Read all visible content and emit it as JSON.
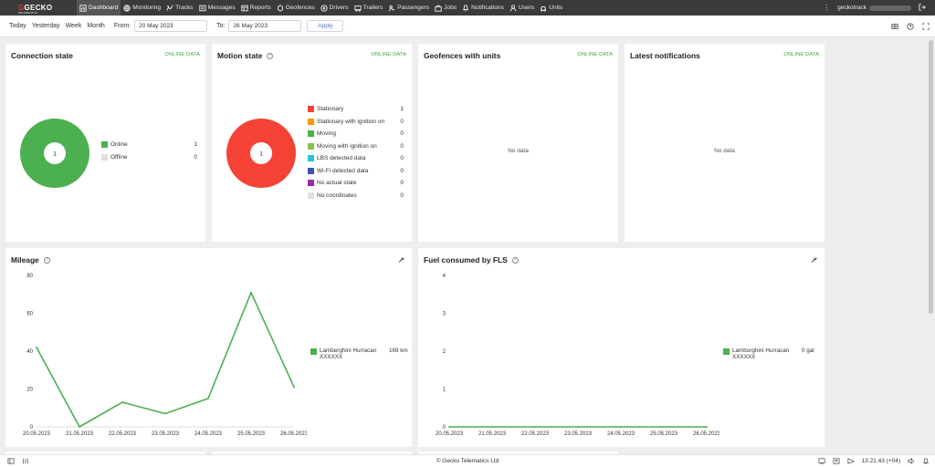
{
  "app": {
    "logo_text": "GECKO",
    "logo_sub": "TELEMATICS"
  },
  "nav": [
    {
      "label": "Dashboard",
      "icon": "dashboard-icon",
      "active": true
    },
    {
      "label": "Monitoring",
      "icon": "globe-icon"
    },
    {
      "label": "Tracks",
      "icon": "tracks-icon"
    },
    {
      "label": "Messages",
      "icon": "messages-icon"
    },
    {
      "label": "Reports",
      "icon": "reports-icon"
    },
    {
      "label": "Geofences",
      "icon": "geofences-icon"
    },
    {
      "label": "Drivers",
      "icon": "drivers-icon"
    },
    {
      "label": "Trailers",
      "icon": "trailers-icon"
    },
    {
      "label": "Passengers",
      "icon": "passengers-icon"
    },
    {
      "label": "Jobs",
      "icon": "jobs-icon"
    },
    {
      "label": "Notifications",
      "icon": "notifications-icon"
    },
    {
      "label": "Users",
      "icon": "users-icon"
    },
    {
      "label": "Units",
      "icon": "units-icon"
    }
  ],
  "user": {
    "name": "geckotrack"
  },
  "filter": {
    "today": "Today",
    "yesterday": "Yesterday",
    "week": "Week",
    "month": "Month",
    "from_label": "From:",
    "from_value": "20 May 2023",
    "to_label": "To:",
    "to_value": "26 May 2023",
    "apply": "Apply"
  },
  "online_label": "ONLINE DATA",
  "no_data": "No data",
  "connection": {
    "title": "Connection state",
    "center": "1",
    "items": [
      {
        "label": "Online",
        "value": "1",
        "color": "#4caf50"
      },
      {
        "label": "Offline",
        "value": "0",
        "color": "#e0e0e0"
      }
    ]
  },
  "motion": {
    "title": "Motion state",
    "center": "1",
    "items": [
      {
        "label": "Stationary",
        "value": "1",
        "color": "#f44336"
      },
      {
        "label": "Stationary with ignition on",
        "value": "0",
        "color": "#ff9800"
      },
      {
        "label": "Moving",
        "value": "0",
        "color": "#4caf50"
      },
      {
        "label": "Moving with ignition on",
        "value": "0",
        "color": "#8bc34a"
      },
      {
        "label": "LBS detected data",
        "value": "0",
        "color": "#26c6da"
      },
      {
        "label": "Wi-Fi detected data",
        "value": "0",
        "color": "#3f51b5"
      },
      {
        "label": "No actual state",
        "value": "0",
        "color": "#9c27b0"
      },
      {
        "label": "No coordinates",
        "value": "0",
        "color": "#e0e0e0"
      }
    ]
  },
  "geofences": {
    "title": "Geofences with units"
  },
  "notifications": {
    "title": "Latest notifications"
  },
  "mileage": {
    "title": "Mileage",
    "legend_name": "Lamberghini Hurracan XXXXXX",
    "legend_value": "169 km"
  },
  "fuel": {
    "title": "Fuel consumed by FLS",
    "legend_name": "Lamborghini Hurracan XXXXXX",
    "legend_value": "0 gal"
  },
  "footer": {
    "copyright": "© Gecko Telematics Ltd",
    "time": "13:21:43 (+04)"
  },
  "chart_data": [
    {
      "type": "line",
      "title": "Mileage",
      "x": [
        "20.05.2023",
        "21.05.2023",
        "22.05.2023",
        "23.05.2023",
        "24.05.2023",
        "25.05.2023",
        "26.05.2023"
      ],
      "series": [
        {
          "name": "Lamberghini Hurracan XXXXXX",
          "values": [
            42,
            0,
            13,
            7,
            15,
            71,
            21
          ],
          "color": "#4caf50"
        }
      ],
      "ylim": [
        0,
        80
      ],
      "yticks": [
        0,
        20,
        40,
        60,
        80
      ],
      "grid": false,
      "legend": "right"
    },
    {
      "type": "line",
      "title": "Fuel consumed by FLS",
      "x": [
        "20.05.2023",
        "21.05.2023",
        "22.05.2023",
        "23.05.2023",
        "24.05.2023",
        "25.05.2023",
        "26.05.2023"
      ],
      "series": [
        {
          "name": "Lamborghini Hurracan XXXXXX",
          "values": [
            0,
            0,
            0,
            0,
            0,
            0,
            0
          ],
          "color": "#4caf50"
        }
      ],
      "ylim": [
        0,
        4
      ],
      "yticks": [
        0,
        1,
        2,
        3,
        4
      ],
      "grid": false,
      "legend": "right"
    }
  ]
}
